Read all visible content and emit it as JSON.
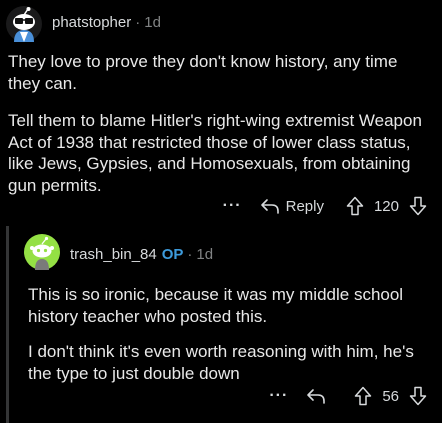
{
  "comment": {
    "author": "phatstopher",
    "separator": "·",
    "age": "1d",
    "paragraphs": [
      "They love to prove they don't know history, any time they can.",
      "Tell them to blame Hitler's right-wing extremist Weapon Act of 1938 that restricted those of lower class status, like Jews, Gypsies, and Homosexuals, from obtaining gun permits."
    ],
    "actions": {
      "more_label": "···",
      "reply_label": "Reply",
      "score": "120"
    }
  },
  "reply": {
    "author": "trash_bin_84",
    "op_badge": "OP",
    "separator": "·",
    "age": "1d",
    "paragraphs": [
      "This is so ironic, because it was my middle school history teacher who posted this.",
      "I don't think it's even worth reasoning with him, he's the type to just double down"
    ],
    "actions": {
      "more_label": "···",
      "score": "56"
    }
  },
  "icons": {
    "top_avatar": "snoo-avatar-icon",
    "reply_avatar": "snoo-avatar-icon",
    "reply": "reply-arrow-icon",
    "upvote": "upvote-arrow-icon",
    "downvote": "downvote-arrow-icon",
    "more": "more-dots-icon"
  },
  "colors": {
    "background": "#000000",
    "text": "#d7dadc",
    "muted": "#818384",
    "op_badge": "#3d9bdb",
    "thread_line": "#343536",
    "reply_avatar_bg": "#94e044"
  }
}
